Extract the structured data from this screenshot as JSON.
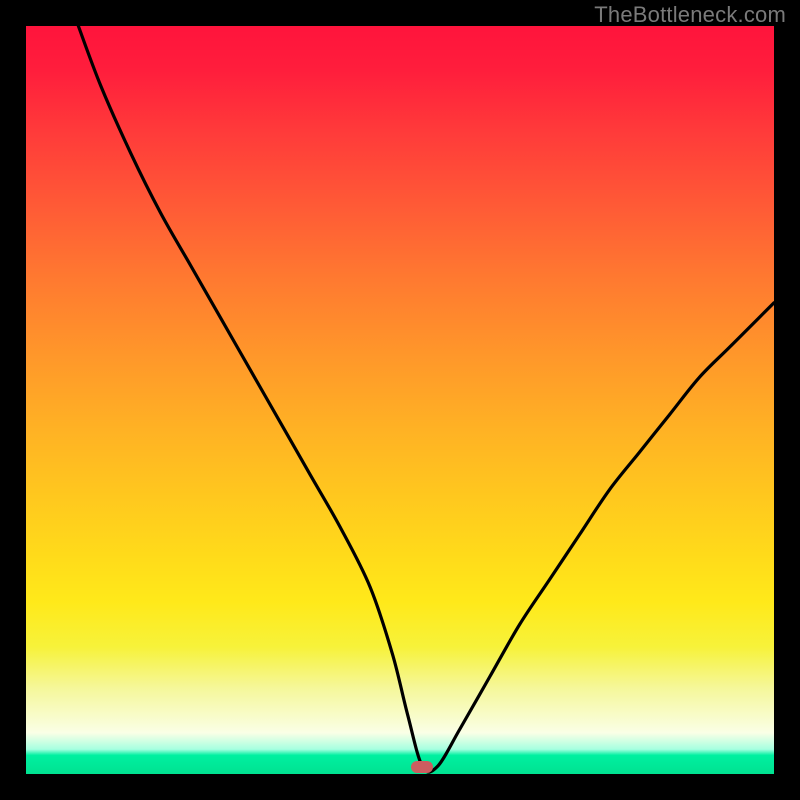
{
  "watermark": "TheBottleneck.com",
  "colors": {
    "frame": "#000000",
    "curve": "#000000",
    "marker": "#cc5d60"
  },
  "chart_data": {
    "type": "line",
    "title": "",
    "xlabel": "",
    "ylabel": "",
    "xlim": [
      0,
      100
    ],
    "ylim": [
      0,
      100
    ],
    "grid": false,
    "legend": false,
    "marker": {
      "x": 53,
      "y": 1
    },
    "series": [
      {
        "name": "bottleneck-curve",
        "x": [
          7,
          10,
          14,
          18,
          22,
          26,
          30,
          34,
          38,
          42,
          46,
          49,
          51,
          53,
          55,
          58,
          62,
          66,
          70,
          74,
          78,
          82,
          86,
          90,
          94,
          98,
          100
        ],
        "y": [
          100,
          92,
          83,
          75,
          68,
          61,
          54,
          47,
          40,
          33,
          25,
          16,
          8,
          1,
          1,
          6,
          13,
          20,
          26,
          32,
          38,
          43,
          48,
          53,
          57,
          61,
          63
        ]
      }
    ]
  }
}
